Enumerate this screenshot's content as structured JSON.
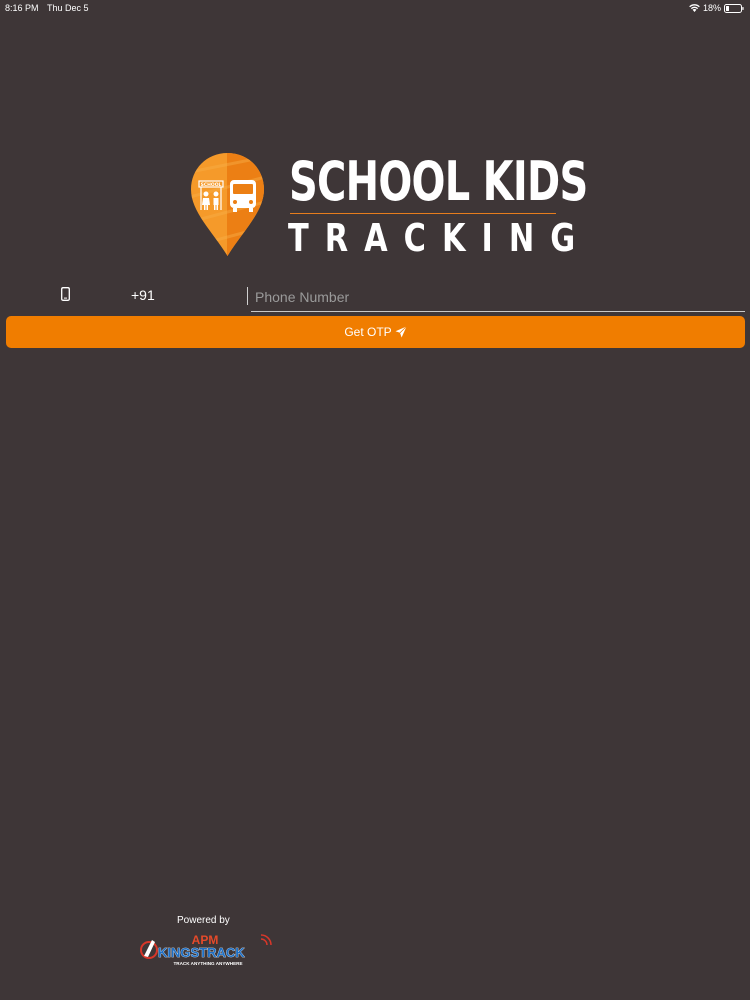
{
  "status_bar": {
    "time": "8:16 PM",
    "date": "Thu Dec 5",
    "battery": "18%",
    "icons": [
      "wifi-icon",
      "battery-icon"
    ]
  },
  "logo": {
    "title": "SCHOOL KIDS",
    "subtitle": "TRACKING",
    "badge_text": "SCHOOL"
  },
  "login": {
    "phone_icon": "phone-icon",
    "country_code": "+91",
    "phone_placeholder": "Phone Number",
    "phone_value": "",
    "otp_button_label": "Get OTP",
    "otp_button_icon": "send-icon"
  },
  "footer": {
    "powered_by": "Powered by",
    "brand_top": "APM",
    "brand_name": "KINGSTRACK",
    "brand_tagline": "TRACK ANYTHING ANYWHERE"
  },
  "colors": {
    "background": "#3e3637",
    "accent": "#f07d00"
  }
}
